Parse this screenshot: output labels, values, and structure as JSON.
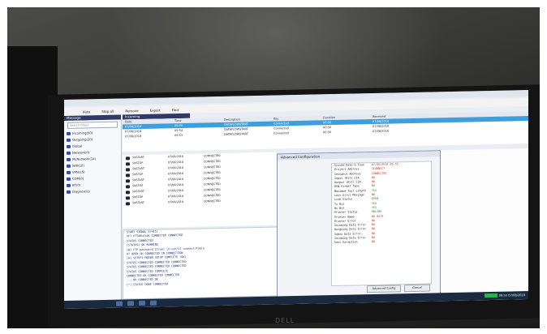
{
  "toolbar": {
    "items": [
      "Auto",
      "Stop all",
      "Remove",
      "Export",
      "Find"
    ]
  },
  "panes": {
    "messages_header": "Message",
    "incoming_header": "Incoming",
    "search_placeholder": "Search Filters"
  },
  "sidebar": {
    "items": [
      "Incoming(50)",
      "Outgoing(20)",
      "Global",
      "Network(0)",
      "MyNetwork(14)",
      "Wifi(18)",
      "VPN(15)",
      "COM(0)",
      "BT(0)",
      "Diagnostics"
    ]
  },
  "top_table": {
    "columns": [
      "Date",
      "Time",
      "Description",
      "Key",
      "Duration",
      "Received"
    ],
    "rows": [
      {
        "cells": [
          "07/08/2018",
          "09:55",
          "DATAFLOWSTART",
          "Connected",
          "00:00",
          "07/08/2018"
        ],
        "selected": true
      },
      {
        "cells": [
          "07/08/2018",
          "09:54",
          "DATAFLOWSTART",
          "Connected",
          "00:00",
          "07/08/2018"
        ],
        "selected": false
      },
      {
        "cells": [
          "07/08/2018",
          "09:53",
          "DATAFLOWSTART",
          "Connected",
          "00:00",
          "07/08/2018"
        ],
        "selected": false
      }
    ]
  },
  "sub_table": {
    "rows": [
      [
        "SNSTART",
        "07/08/2018",
        "CONNECTED"
      ],
      [
        "SNSTOP",
        "07/08/2018",
        "CONNECTED"
      ],
      [
        "SNSTART",
        "07/08/2018",
        "CONNECTED"
      ],
      [
        "SNSTOP",
        "07/08/2018",
        "CONNECTED"
      ],
      [
        "SNSTART",
        "07/08/2018",
        "CONNECTED"
      ],
      [
        "SNSTOP",
        "07/08/2018",
        "CONNECTED"
      ],
      [
        "SNSTART",
        "07/08/2018",
        "CONNECTED"
      ],
      [
        "SNSTOP",
        "07/08/2018",
        "CONNECTED"
      ],
      [
        "SNSTART",
        "07/08/2018",
        "CONNECTED"
      ]
    ]
  },
  "console": {
    "lines": [
      "START SIGNAL 4(H11)",
      "VFT PTTABLELOG CONNECTED CONNECTED",
      "STATUS CONNECTED",
      "[STATUS] OK RUNNING",
      "[W] FTP:password [true] in:ssh/17 connect/Table",
      "  AT  OPEN.SH CONNECTED  IN  CONNECTION",
      "  [A] SETUP1 MODEM  SETUP  COMPLETE  (OK)",
      "    STATUS CONNECTED  CONNECTED  CONNECTED",
      "    STATUS CONNECTED  CONNECTED  CONNECTED",
      "    STATUS CONNECTED  COMPLETE",
      "    CONNECTED  OK  CONNECTED  CONNECTED",
      "    ...  OK  CONNECTED  OK",
      "  [*] STATUS  DONE  CONNECTED"
    ]
  },
  "dialog": {
    "title": "Advanced Configuration",
    "fields": [
      {
        "k": "System Date & Time",
        "v": "07/08/2018 09:55",
        "ok": false
      },
      {
        "k": "Project Address",
        "v": "3CONNECT",
        "ok": false
      },
      {
        "k": "Instance Address",
        "v": "CONNECTED",
        "ok": false
      },
      {
        "k": "Input (Bit) CIA",
        "v": "NO",
        "ok": false
      },
      {
        "k": "Output (Bit) CIA",
        "v": "NO",
        "ok": false
      },
      {
        "k": "DSN Format Type",
        "v": "NO",
        "ok": false
      },
      {
        "k": "Maximum Tool Length",
        "v": "YES",
        "ok": true
      },
      {
        "k": "Last Error Message",
        "v": "NO",
        "ok": false
      },
      {
        "k": "Link Status",
        "v": "OPEN",
        "ok": true
      },
      {
        "k": "Tx Bit",
        "v": "YES",
        "ok": true
      },
      {
        "k": "Rx Bit",
        "v": "YES",
        "ok": true
      },
      {
        "k": "Printer Status",
        "v": "ONLINE",
        "ok": true
      },
      {
        "k": "Printer Name",
        "v": "NO DATA",
        "ok": false
      },
      {
        "k": "Printer Error",
        "v": "NO",
        "ok": false
      },
      {
        "k": "Incoming Data Error",
        "v": "NO",
        "ok": false
      },
      {
        "k": "Outgoing Data Error",
        "v": "NO",
        "ok": false
      },
      {
        "k": "Inbox Data Error",
        "v": "NO",
        "ok": false
      },
      {
        "k": "Incoming Data Error",
        "v": "NO",
        "ok": false
      },
      {
        "k": "Sent Exception",
        "v": "NO",
        "ok": false
      }
    ],
    "buttons": [
      "Advanced Config",
      "Cancel"
    ]
  },
  "taskbar": {
    "clock": "09:55",
    "date": "07/08/2018"
  },
  "brand": "DELL"
}
